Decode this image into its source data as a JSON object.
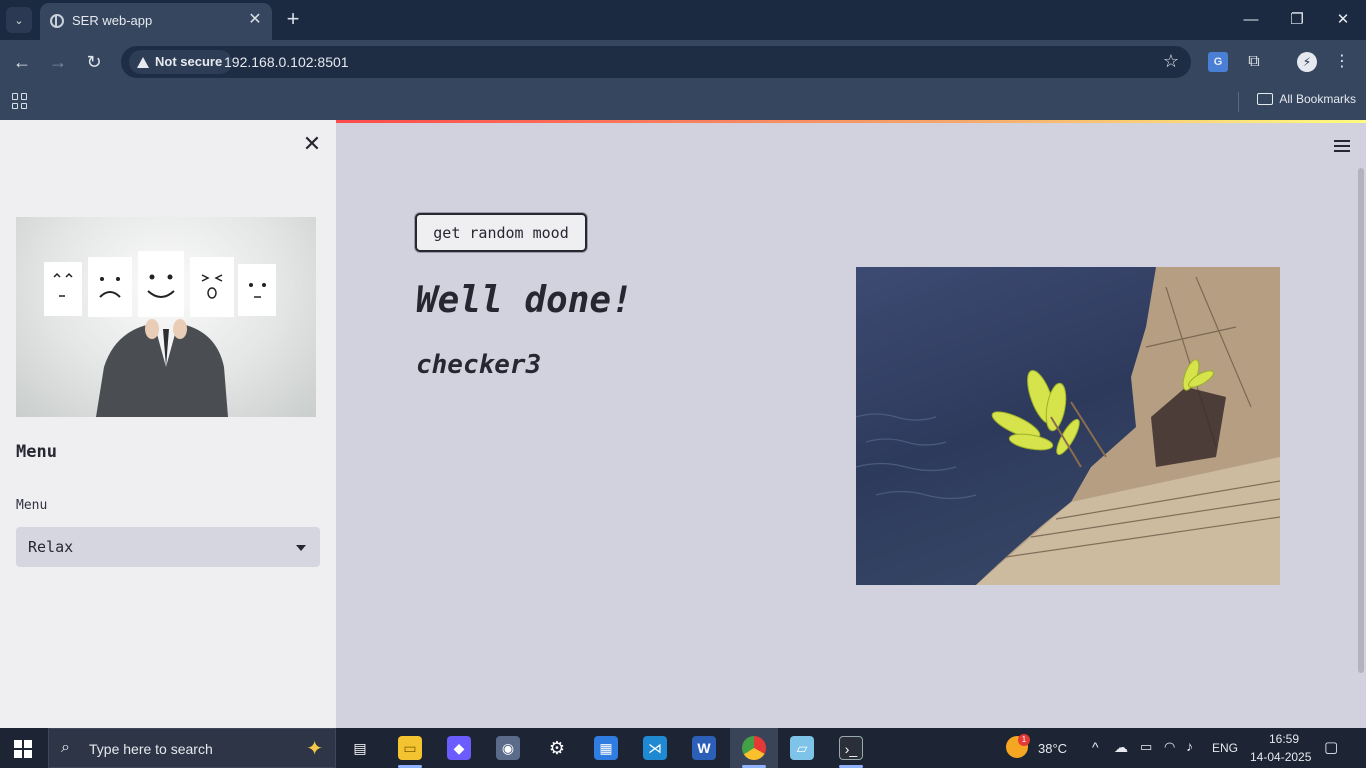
{
  "browser": {
    "tab_title": "SER web-app",
    "security_label": "Not secure",
    "url": "192.168.0.102:8501",
    "all_bookmarks": "All Bookmarks"
  },
  "sidebar": {
    "title": "Menu",
    "select_label": "Menu",
    "select_value": "Relax"
  },
  "main": {
    "button_label": "get random mood",
    "heading": "Well done!",
    "subheading": "checker3"
  },
  "taskbar": {
    "search_placeholder": "Type here to search",
    "temperature": "38°C",
    "language": "ENG",
    "time": "16:59",
    "date": "14-04-2025",
    "notification_count": "1"
  },
  "colors": {
    "app_background": "#d2d2de",
    "sidebar_background": "#efeff2",
    "text": "#262730",
    "accent_gradient_start": "#ff4b4b",
    "accent_gradient_end": "#fffd80"
  }
}
